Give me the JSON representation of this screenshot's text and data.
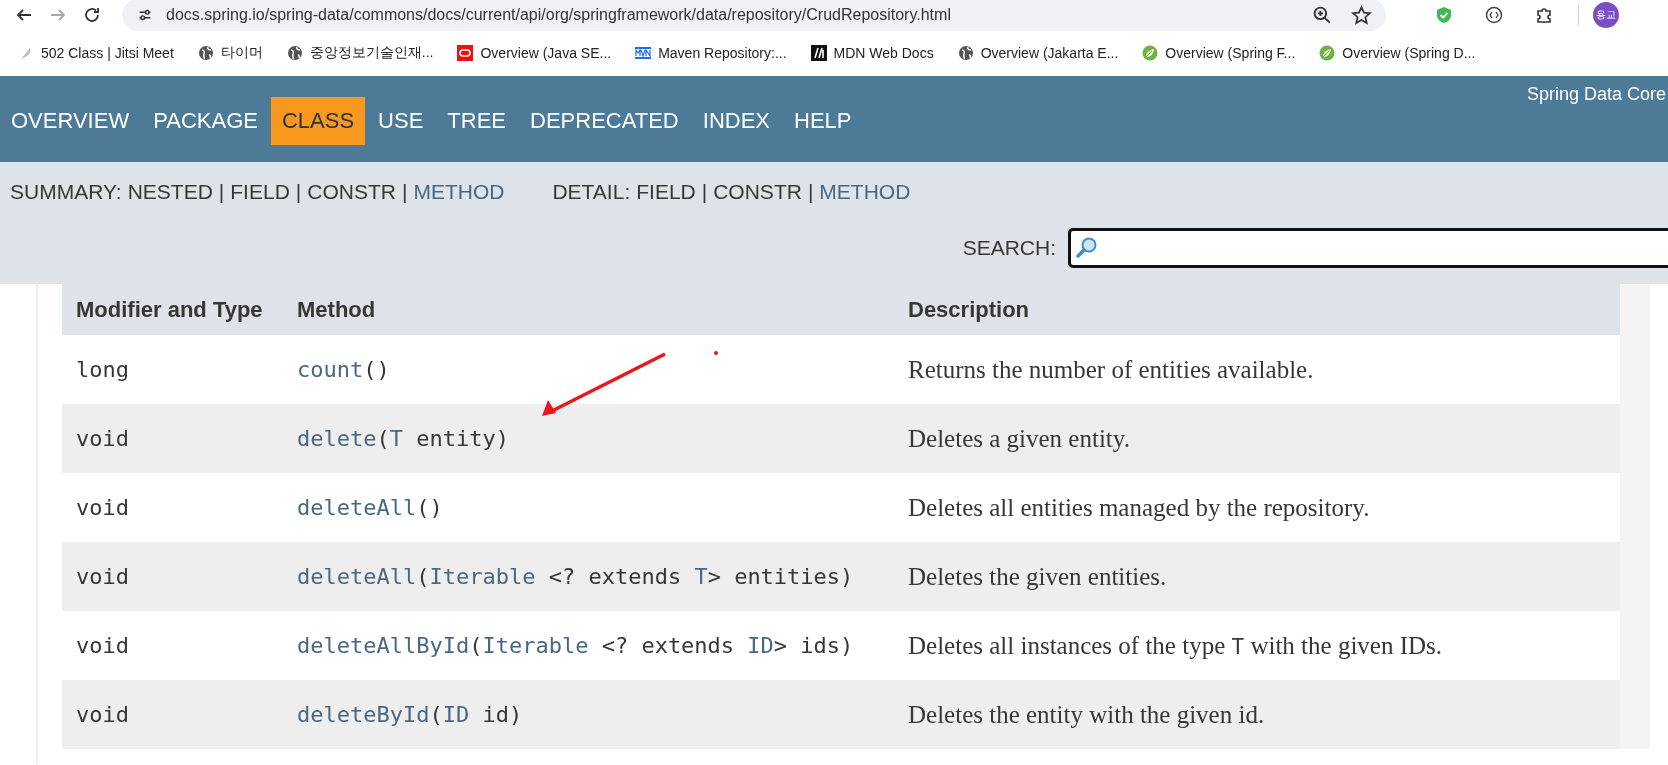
{
  "browser": {
    "url": "docs.spring.io/spring-data/commons/docs/current/api/org/springframework/data/repository/CrudRepository.html",
    "profile": "용교"
  },
  "bookmarks": [
    "502 Class | Jitsi Meet",
    "타이머",
    "중앙정보기술인재...",
    "Overview (Java SE...",
    "Maven Repository:...",
    "MDN Web Docs",
    "Overview (Jakarta E...",
    "Overview (Spring F...",
    "Overview (Spring D..."
  ],
  "nav": {
    "items": [
      {
        "label": "OVERVIEW",
        "selected": false
      },
      {
        "label": "PACKAGE",
        "selected": false
      },
      {
        "label": "CLASS",
        "selected": true
      },
      {
        "label": "USE",
        "selected": false
      },
      {
        "label": "TREE",
        "selected": false
      },
      {
        "label": "DEPRECATED",
        "selected": false
      },
      {
        "label": "INDEX",
        "selected": false
      },
      {
        "label": "HELP",
        "selected": false
      }
    ],
    "product": "Spring Data Core"
  },
  "subnav": {
    "summary": {
      "label": "SUMMARY:",
      "items": [
        {
          "text": "NESTED",
          "link": false
        },
        {
          "text": "FIELD",
          "link": false
        },
        {
          "text": "CONSTR",
          "link": false
        },
        {
          "text": "METHOD",
          "link": true
        }
      ]
    },
    "detail": {
      "label": "DETAIL:",
      "items": [
        {
          "text": "FIELD",
          "link": false
        },
        {
          "text": "CONSTR",
          "link": false
        },
        {
          "text": "METHOD",
          "link": true
        }
      ]
    },
    "separator": "|"
  },
  "search": {
    "label": "SEARCH:"
  },
  "table": {
    "columns": [
      "Modifier and Type",
      "Method",
      "Description"
    ],
    "rows": [
      {
        "type": "long",
        "method": [
          {
            "text": "count",
            "link": true
          },
          {
            "text": "()",
            "link": false
          }
        ],
        "description": [
          {
            "text": "Returns the number of entities available.",
            "code": false
          }
        ]
      },
      {
        "type": "void",
        "method": [
          {
            "text": "delete",
            "link": true
          },
          {
            "text": "(",
            "link": false
          },
          {
            "text": "T",
            "link": true
          },
          {
            "text": " entity)",
            "link": false
          }
        ],
        "description": [
          {
            "text": "Deletes a given entity.",
            "code": false
          }
        ]
      },
      {
        "type": "void",
        "method": [
          {
            "text": "deleteAll",
            "link": true
          },
          {
            "text": "()",
            "link": false
          }
        ],
        "description": [
          {
            "text": "Deletes all entities managed by the repository.",
            "code": false
          }
        ]
      },
      {
        "type": "void",
        "method": [
          {
            "text": "deleteAll",
            "link": true
          },
          {
            "text": "(",
            "link": false
          },
          {
            "text": "Iterable",
            "link": true
          },
          {
            "text": " <? extends ",
            "link": false
          },
          {
            "text": "T",
            "link": true
          },
          {
            "text": "> entities)",
            "link": false
          }
        ],
        "description": [
          {
            "text": "Deletes the given entities.",
            "code": false
          }
        ]
      },
      {
        "type": "void",
        "method": [
          {
            "text": "deleteAllById",
            "link": true
          },
          {
            "text": "(",
            "link": false
          },
          {
            "text": "Iterable",
            "link": true
          },
          {
            "text": " <? extends ",
            "link": false
          },
          {
            "text": "ID",
            "link": true
          },
          {
            "text": "> ids)",
            "link": false
          }
        ],
        "description": [
          {
            "text": "Deletes all instances of the type ",
            "code": false
          },
          {
            "text": "T",
            "code": true
          },
          {
            "text": " with the given IDs.",
            "code": false
          }
        ]
      },
      {
        "type": "void",
        "method": [
          {
            "text": "deleteById",
            "link": true
          },
          {
            "text": "(",
            "link": false
          },
          {
            "text": "ID",
            "link": true
          },
          {
            "text": " id)",
            "link": false
          }
        ],
        "description": [
          {
            "text": "Deletes the entity with the given id.",
            "code": false
          }
        ]
      }
    ]
  }
}
